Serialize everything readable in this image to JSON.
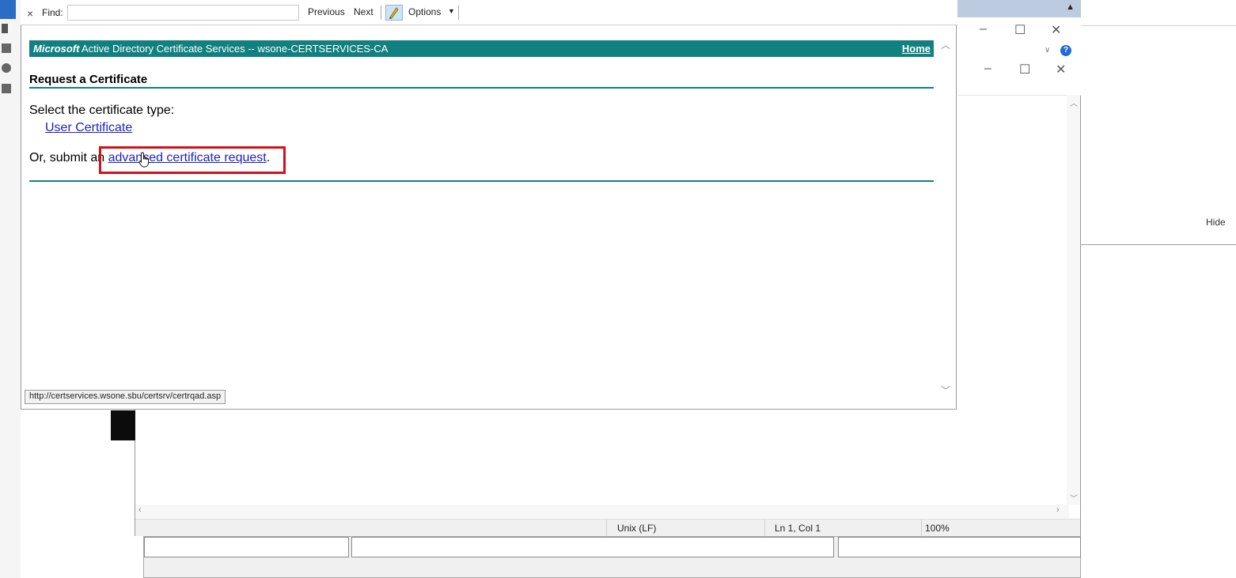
{
  "find_bar": {
    "close_icon": "×",
    "label": "Find:",
    "input_value": "",
    "previous_label": "Previous",
    "next_label": "Next",
    "options_label": "Options",
    "options_caret": "▼"
  },
  "adcs": {
    "brand": "Microsoft",
    "title": "Active Directory Certificate Services  --  wsone-CERTSERVICES-CA",
    "home_link": "Home",
    "page_heading": "Request a Certificate",
    "select_text": "Select the certificate type:",
    "user_certificate_link": "User Certificate",
    "or_text_prefix": "Or, submit an ",
    "advanced_link": "advanced certificate request",
    "or_text_suffix": "."
  },
  "browser": {
    "status_url": "http://certservices.wsone.sbu/certsrv/certrqad.asp",
    "scroll_up_icon": "︿",
    "scroll_down_icon": "﹀"
  },
  "editor": {
    "encoding": "Unix (LF)",
    "position": "Ln 1, Col 1",
    "zoom": "100%"
  },
  "right_pane": {
    "hide_label": "Hide"
  },
  "window_controls": {
    "minimize": "–",
    "maximize": "☐",
    "close": "✕"
  },
  "colors": {
    "adcs_teal": "#138080",
    "link_blue": "#1d24b8",
    "highlight_red": "#d4101a"
  },
  "icons": [
    "close-icon",
    "pen-highlight-icon",
    "chevron-down-icon",
    "hand-cursor-icon",
    "minimize-icon",
    "maximize-icon",
    "close-window-icon",
    "help-icon"
  ]
}
